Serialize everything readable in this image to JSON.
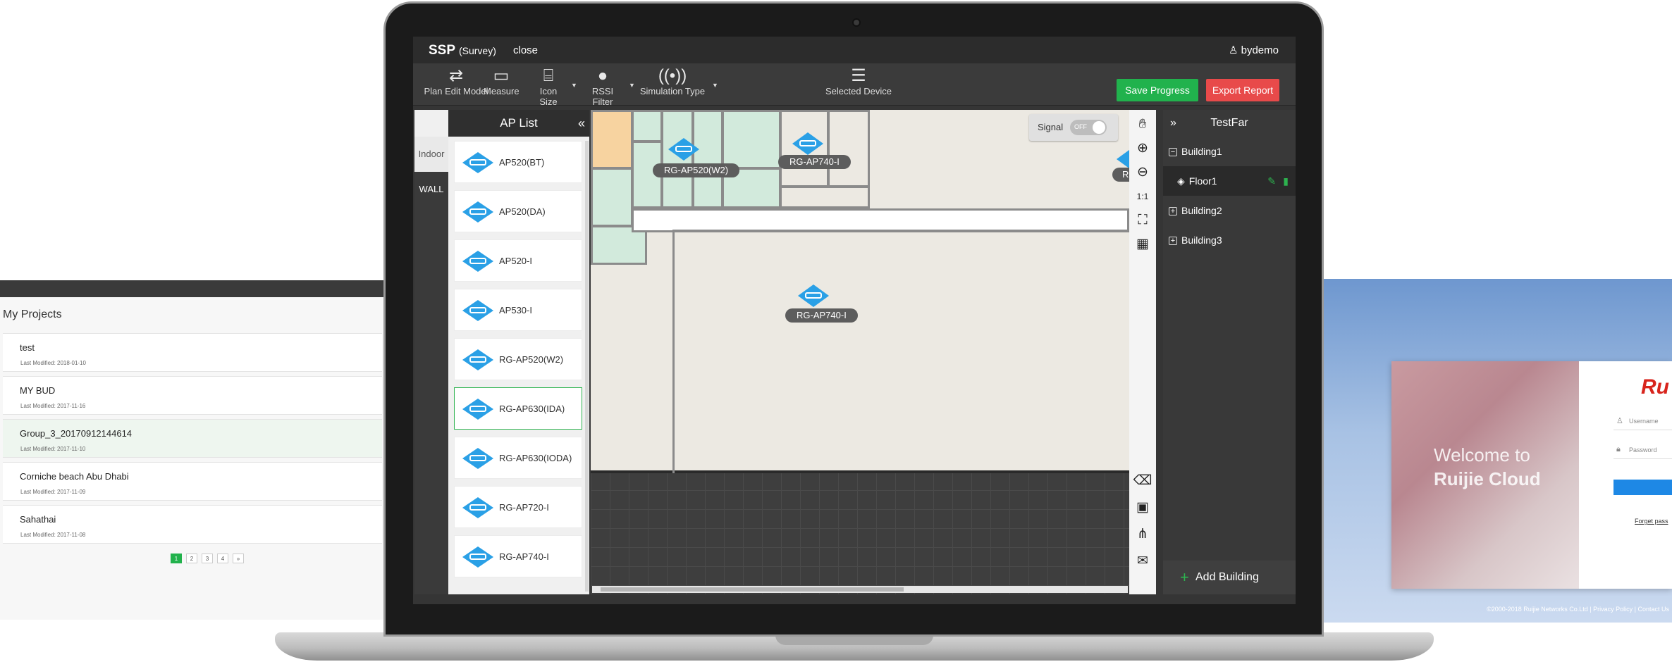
{
  "projects": {
    "title": "My Projects",
    "items": [
      {
        "name": "test",
        "modified": "Last Modified: 2018-01-10"
      },
      {
        "name": "MY BUD",
        "modified": "Last Modified: 2017-11-16"
      },
      {
        "name": "Group_3_20170912144614",
        "modified": "Last Modified: 2017-11-10"
      },
      {
        "name": "Corniche beach Abu Dhabi",
        "modified": "Last Modified: 2017-11-09"
      },
      {
        "name": "Sahathai",
        "modified": "Last Modified: 2017-11-08"
      }
    ],
    "pages": [
      "1",
      "2",
      "3",
      "4",
      "»"
    ]
  },
  "login": {
    "welcome_line1": "Welcome to",
    "welcome_line2": "Ruijie Cloud",
    "brand": "Ru",
    "username_placeholder": "Username",
    "password_placeholder": "Password",
    "forgot": "Forget pass",
    "footer": "©2000-2018 Ruijie Networks Co.Ltd | Privacy Policy | Contact Us"
  },
  "app": {
    "title": "SSP",
    "title_sub": "(Survey)",
    "close": "close",
    "user": "bydemo",
    "toolbar": {
      "plan_edit": "Plan Edit Model",
      "measure": "Measure",
      "icon_size": "Icon Size",
      "rssi_filter": "RSSI Filter",
      "simulation_type": "Simulation Type",
      "selected_device": "Selected Device",
      "save": "Save Progress",
      "export": "Export Report"
    },
    "ap_list": {
      "title": "AP List",
      "collapse": "«",
      "tabs": [
        "Indoor",
        "WALL"
      ],
      "items": [
        "AP520(BT)",
        "AP520(DA)",
        "AP520-I",
        "AP530-I",
        "RG-AP520(W2)",
        "RG-AP630(IDA)",
        "RG-AP630(IODA)",
        "RG-AP720-I",
        "RG-AP740-I"
      ]
    },
    "map": {
      "signal_label": "Signal",
      "signal_state": "OFF",
      "placed": [
        "RG-AP520(W2)",
        "RG-AP740-I",
        "RG-AP740-I",
        "RG-"
      ]
    },
    "tree": {
      "expand": "»",
      "project": "TestFar",
      "buildings": [
        "Building1",
        "Floor1",
        "Building2",
        "Building3"
      ],
      "add_building": "Add Building"
    }
  }
}
